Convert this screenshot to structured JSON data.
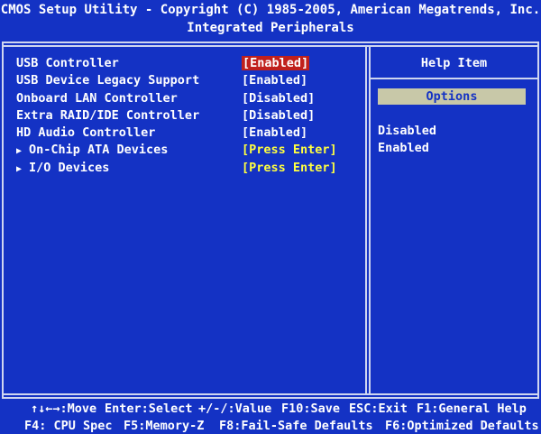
{
  "header": {
    "title": "CMOS Setup Utility - Copyright (C) 1985-2005, American Megatrends, Inc.",
    "subtitle": "Integrated Peripherals"
  },
  "settings": [
    {
      "label": "USB Controller",
      "value": "[Enabled]",
      "submenu": false,
      "selected": true
    },
    {
      "label": "USB Device Legacy Support",
      "value": "[Enabled]",
      "submenu": false,
      "selected": false
    },
    {
      "label": "Onboard LAN Controller",
      "value": "[Disabled]",
      "submenu": false,
      "selected": false
    },
    {
      "label": "Extra RAID/IDE Controller",
      "value": "[Disabled]",
      "submenu": false,
      "selected": false
    },
    {
      "label": "HD Audio Controller",
      "value": "[Enabled]",
      "submenu": false,
      "selected": false
    },
    {
      "label": "On-Chip ATA Devices",
      "value": "[Press Enter]",
      "submenu": true,
      "selected": false
    },
    {
      "label": "I/O Devices",
      "value": "[Press Enter]",
      "submenu": true,
      "selected": false
    }
  ],
  "help": {
    "title": "Help Item",
    "options_label": "Options",
    "options": [
      "Disabled",
      "Enabled"
    ]
  },
  "footer": {
    "line1": [
      "↑↓←→:Move",
      "Enter:Select",
      "+/-/:Value",
      "F10:Save",
      "ESC:Exit",
      "F1:General Help"
    ],
    "line2": [
      "F4: CPU Spec",
      "F5:Memory-Z",
      "F8:Fail-Safe Defaults",
      "F6:Optimized Defaults"
    ]
  },
  "colors": {
    "background": "#1432c4",
    "selected": "#c0201c",
    "submenu_value": "#ffff40",
    "options_box": "#c8c8a8"
  },
  "icons": {
    "submenu": "triangle-right-icon"
  }
}
